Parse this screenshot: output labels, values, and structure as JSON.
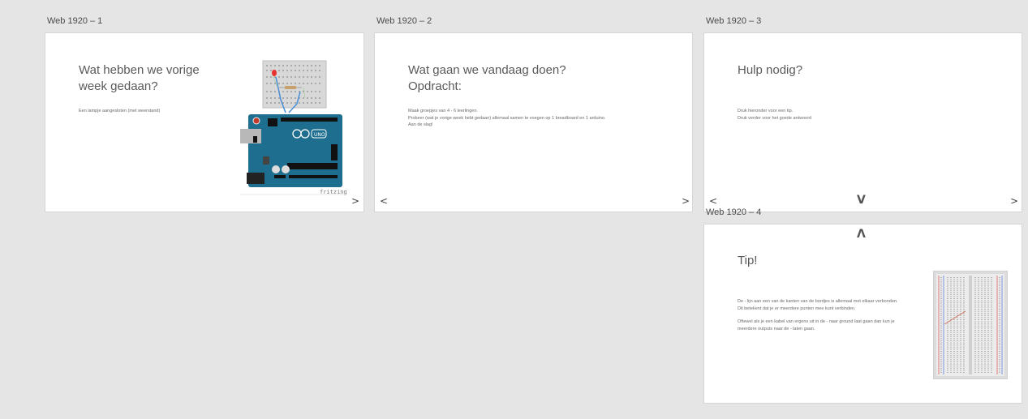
{
  "artboards": [
    {
      "label": "Web 1920 – 1",
      "title": "Wat hebben we vorige\nweek gedaan?",
      "body": "Een lampje aangesloten (met weerstand)",
      "image_caption": "fritzing",
      "nav_next": ">"
    },
    {
      "label": "Web 1920 – 2",
      "title": "Wat gaan we vandaag doen?\nOpdracht:",
      "body": "Maak groepjes van 4 - 6 leerlingen.\nProbeer (wat je vorige week hebt gedaan) allemaal samen te voegen op 1 breadboard en 1 arduino.\nAan de slag!",
      "nav_prev": "<",
      "nav_next": ">"
    },
    {
      "label": "Web 1920 – 3",
      "title": "Hulp nodig?",
      "body": "Druk hieronder voor een tip.\nDruk verder voor het goede antwoord",
      "nav_prev": "<",
      "nav_down": "V",
      "nav_next": ">"
    },
    {
      "label": "Web 1920 – 4",
      "title": "Tip!",
      "body_1": "De - lijn aan een van de kanten van de bordjes is allemaal met elkaar verbonden.\nDit betekent dat je er meerdere punten mee kunt verbinden.",
      "body_2": "Oftewel als je een kabel van ergens uit in de - naar ground laat gaan dan kun je\nmeerdere outputs naar de - laten gaan.",
      "nav_up": "Λ"
    }
  ],
  "colors": {
    "canvas": "#e5e5e5",
    "arduino": "#1e6f8f",
    "breadboard": "#dcdcdc"
  }
}
